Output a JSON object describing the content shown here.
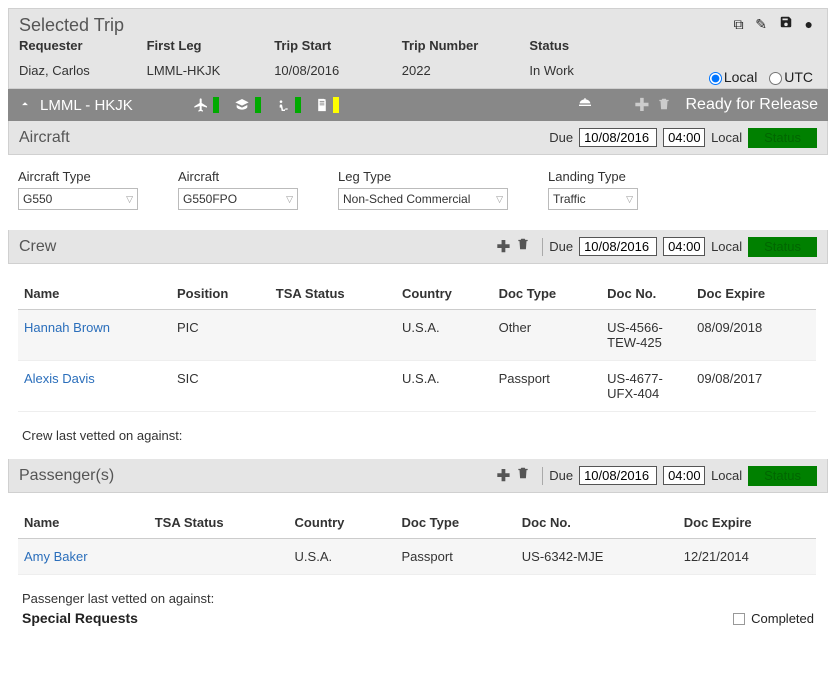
{
  "header": {
    "title": "Selected Trip",
    "cols": [
      {
        "label": "Requester",
        "value": "Diaz, Carlos"
      },
      {
        "label": "First Leg",
        "value": "LMML-HKJK"
      },
      {
        "label": "Trip Start",
        "value": "10/08/2016"
      },
      {
        "label": "Trip Number",
        "value": "2022"
      },
      {
        "label": "Status",
        "value": "In Work"
      }
    ],
    "tz_local": "Local",
    "tz_utc": "UTC"
  },
  "legbar": {
    "name": "LMML - HKJK",
    "ready": "Ready for Release"
  },
  "aircraft": {
    "title": "Aircraft",
    "due_label": "Due",
    "date": "10/08/2016",
    "time": "04:00",
    "tz": "Local",
    "status_btn": "Status",
    "fields": {
      "type_label": "Aircraft Type",
      "type_value": "G550",
      "aircraft_label": "Aircraft",
      "aircraft_value": "G550FPO",
      "legtype_label": "Leg Type",
      "legtype_value": "Non-Sched Commercial",
      "landing_label": "Landing Type",
      "landing_value": "Traffic"
    }
  },
  "crew": {
    "title": "Crew",
    "due_label": "Due",
    "date": "10/08/2016",
    "time": "04:00",
    "tz": "Local",
    "status_btn": "Status",
    "columns": [
      "Name",
      "Position",
      "TSA Status",
      "Country",
      "Doc Type",
      "Doc No.",
      "Doc Expire"
    ],
    "rows": [
      {
        "name": "Hannah Brown",
        "position": "PIC",
        "tsa": "",
        "country": "U.S.A.",
        "doctype": "Other",
        "docno": "US-4566-TEW-425",
        "docexp": "08/09/2018"
      },
      {
        "name": "Alexis Davis",
        "position": "SIC",
        "tsa": "",
        "country": "U.S.A.",
        "doctype": "Passport",
        "docno": "US-4677-UFX-404",
        "docexp": "09/08/2017"
      }
    ],
    "footnote": "Crew last vetted on against:"
  },
  "passengers": {
    "title": "Passenger(s)",
    "due_label": "Due",
    "date": "10/08/2016",
    "time": "04:00",
    "tz": "Local",
    "status_btn": "Status",
    "columns": [
      "Name",
      "TSA Status",
      "Country",
      "Doc Type",
      "Doc No.",
      "Doc Expire"
    ],
    "rows": [
      {
        "name": "Amy Baker",
        "tsa": "",
        "country": "U.S.A.",
        "doctype": "Passport",
        "docno": "US-6342-MJE",
        "docexp": "12/21/2014"
      }
    ],
    "footnote": "Passenger last vetted on against:"
  },
  "special": {
    "title": "Special Requests",
    "completed": "Completed"
  }
}
